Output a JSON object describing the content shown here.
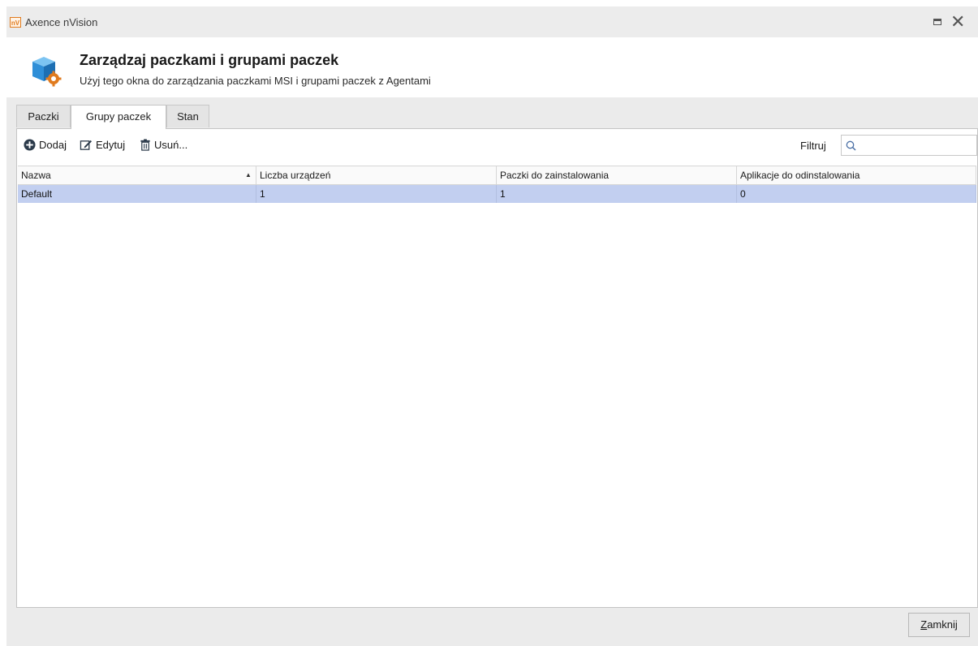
{
  "window": {
    "app_logo_text": "nV",
    "title": "Axence nVision",
    "maximize_icon": "maximize-icon",
    "close_icon": "close-icon"
  },
  "header": {
    "title": "Zarządzaj paczkami i grupami paczek",
    "subtitle": "Użyj tego okna do zarządzania paczkami MSI i grupami paczek z Agentami",
    "icon": "package-settings-icon"
  },
  "tabs": [
    {
      "label": "Paczki",
      "active": false
    },
    {
      "label": "Grupy paczek",
      "active": true
    },
    {
      "label": "Stan",
      "active": false
    }
  ],
  "toolbar": {
    "add_label": "Dodaj",
    "edit_label": "Edytuj",
    "delete_label": "Usuń...",
    "filter_label": "Filtruj",
    "filter_value": ""
  },
  "table": {
    "columns": [
      "Nazwa",
      "Liczba urządzeń",
      "Paczki do zainstalowania",
      "Aplikacje do odinstalowania"
    ],
    "sort_column": "Nazwa",
    "sort_direction": "ascending",
    "rows": [
      {
        "cells": [
          "Default",
          "1",
          "1",
          "0"
        ],
        "selected": true
      }
    ]
  },
  "footer": {
    "close_prefix": "",
    "close_mnemonic": "Z",
    "close_rest": "amknij"
  },
  "colors": {
    "selection": "#c2cff0",
    "accent_orange": "#e07b1f",
    "icon_blue": "#2f8fd8"
  }
}
